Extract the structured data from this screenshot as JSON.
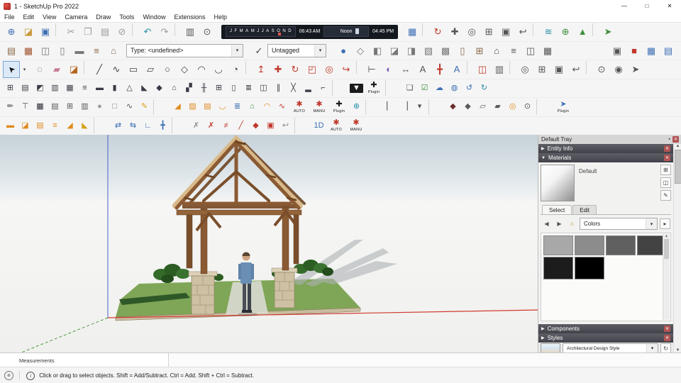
{
  "title_bar": {
    "title": "1 - SketchUp Pro 2022",
    "controls": {
      "minimize": "—",
      "maximize": "□",
      "close": "✕"
    }
  },
  "menu_bar": {
    "items": [
      "File",
      "Edit",
      "View",
      "Camera",
      "Draw",
      "Tools",
      "Window",
      "Extensions",
      "Help"
    ]
  },
  "glyphs": {
    "pin": "▪",
    "close": "✕",
    "collapsed": "▶",
    "expanded": "▼",
    "back": "◀",
    "forward": "▶",
    "home": "⌂",
    "details": "▸",
    "scroll_up": "▲",
    "scroll_down": "▼",
    "check": "✓",
    "caret": "▾",
    "select_arrow": "➤",
    "info": "i",
    "divider": "│",
    "geo": "⊕",
    "refresh": "↻"
  },
  "shadow_toolbar": {
    "months": [
      "J",
      "F",
      "M",
      "A",
      "M",
      "J",
      "J",
      "A",
      "S",
      "O",
      "N",
      "D"
    ],
    "time_start": "06:43 AM",
    "time_mid": "Noon",
    "time_end": "04:45 PM"
  },
  "tag_toolbar": {
    "type_value": "Type: <undefined>",
    "tag_value": "Untagged"
  },
  "toolbars": {
    "row1_left": [
      {
        "n": "new-icon",
        "g": "⊕",
        "c": "#3d6fb4"
      },
      {
        "n": "open-icon",
        "g": "◪",
        "c": "#c99a3c"
      },
      {
        "n": "save-icon",
        "g": "▣",
        "c": "#3d6fb4"
      },
      {
        "t": "sep"
      },
      {
        "n": "cut-icon",
        "g": "✂",
        "c": "#9a9a9a"
      },
      {
        "n": "copy-icon",
        "g": "❐",
        "c": "#9a9a9a"
      },
      {
        "n": "paste-icon",
        "g": "▤",
        "c": "#9a9a9a"
      },
      {
        "n": "erase-icon",
        "g": "⊘",
        "c": "#9a9a9a"
      },
      {
        "t": "sep"
      },
      {
        "n": "undo-icon",
        "g": "↶",
        "c": "#2a8fa8"
      },
      {
        "n": "redo-icon",
        "g": "↷",
        "c": "#9a9a9a"
      },
      {
        "t": "sep"
      },
      {
        "n": "print-icon",
        "g": "▥",
        "c": "#555555"
      },
      {
        "n": "model-info-icon",
        "g": "⊙",
        "c": "#555555"
      }
    ],
    "row1_right": [
      {
        "n": "shadow-settings-icon",
        "g": "▦",
        "c": "#3d6fb4"
      },
      {
        "t": "sep"
      },
      {
        "n": "orbit-icon",
        "g": "↻",
        "c": "#c0392b"
      },
      {
        "n": "pan-icon",
        "g": "✚",
        "c": "#555555"
      },
      {
        "n": "zoom-icon",
        "g": "◎",
        "c": "#555555"
      },
      {
        "n": "zoom-window-icon",
        "g": "⊞",
        "c": "#555555"
      },
      {
        "n": "zoom-extents-icon",
        "g": "▣",
        "c": "#555555"
      },
      {
        "n": "previous-view-icon",
        "g": "↩",
        "c": "#555555"
      },
      {
        "t": "sep"
      },
      {
        "n": "sandbox-icon",
        "g": "≋",
        "c": "#2a8fa8"
      },
      {
        "n": "add-location-icon",
        "g": "⊕",
        "c": "#3c8f3c"
      },
      {
        "n": "terrain-toggle-icon",
        "g": "▲",
        "c": "#3c8f3c"
      },
      {
        "t": "sep"
      },
      {
        "n": "export-icon",
        "g": "➤",
        "c": "#3c8f3c"
      }
    ],
    "row2_left": [
      {
        "n": "wall-tool-icon",
        "g": "▤",
        "c": "#8a6a4a"
      },
      {
        "n": "brick-tool-icon",
        "g": "▦",
        "c": "#a0522d"
      },
      {
        "n": "opening-tool-icon",
        "g": "◫",
        "c": "#777777"
      },
      {
        "n": "column-tool-icon",
        "g": "▯",
        "c": "#777777"
      },
      {
        "n": "slab-tool-icon",
        "g": "▬",
        "c": "#777777"
      },
      {
        "n": "stair-tool-icon",
        "g": "≡",
        "c": "#8a6a4a"
      },
      {
        "n": "roof-tool-icon",
        "g": "⌂",
        "c": "#8a6a4a"
      }
    ],
    "row2_shapes": [
      {
        "n": "sphere-tool-icon",
        "g": "●",
        "c": "#3d6fb4"
      },
      {
        "n": "polygon-tool-icon",
        "g": "◇",
        "c": "#777777"
      },
      {
        "n": "split-tool-icon",
        "g": "◧",
        "c": "#777777"
      },
      {
        "n": "solid-union-icon",
        "g": "◪",
        "c": "#777777"
      },
      {
        "n": "solid-subtract-icon",
        "g": "◨",
        "c": "#777777"
      },
      {
        "n": "solid-trim-icon",
        "g": "▧",
        "c": "#777777"
      },
      {
        "n": "solid-intersect-icon",
        "g": "▩",
        "c": "#777777"
      },
      {
        "n": "door-tool-icon",
        "g": "▯",
        "c": "#8a6a4a"
      },
      {
        "n": "window-tool-icon",
        "g": "⊞",
        "c": "#8a6a4a"
      },
      {
        "n": "house-tool-icon",
        "g": "⌂",
        "c": "#555555"
      },
      {
        "n": "fence-tool-icon",
        "g": "≡",
        "c": "#555555"
      },
      {
        "n": "frame-tool-icon",
        "g": "◫",
        "c": "#555555"
      },
      {
        "n": "grid-tool-icon",
        "g": "▦",
        "c": "#555555"
      }
    ],
    "row2_right": [
      {
        "n": "component-box-icon",
        "g": "▣",
        "c": "#555555"
      },
      {
        "n": "red-material-icon",
        "g": "■",
        "c": "#c0392b"
      },
      {
        "n": "blue-grid-icon",
        "g": "▦",
        "c": "#3d6fb4"
      },
      {
        "n": "layout-table-icon",
        "g": "▤",
        "c": "#3d6fb4"
      }
    ],
    "row3": [
      {
        "n": "lasso-select-icon",
        "g": "◌",
        "c": "#555555"
      },
      {
        "n": "eraser-icon",
        "g": "▰",
        "c": "#c77d9a"
      },
      {
        "n": "paint-bucket-icon",
        "g": "◪",
        "c": "#b5651d"
      },
      {
        "t": "sep"
      },
      {
        "n": "line-icon",
        "g": "╱",
        "c": "#444444"
      },
      {
        "n": "freehand-icon",
        "g": "∿",
        "c": "#444444"
      },
      {
        "n": "rectangle-icon",
        "g": "▭",
        "c": "#444444"
      },
      {
        "n": "rotated-rectangle-icon",
        "g": "▱",
        "c": "#444444"
      },
      {
        "n": "circle-icon",
        "g": "○",
        "c": "#444444"
      },
      {
        "n": "polygon-icon",
        "g": "◇",
        "c": "#444444"
      },
      {
        "n": "arc-icon",
        "g": "◠",
        "c": "#444444"
      },
      {
        "n": "two-point-arc-icon",
        "g": "◡",
        "c": "#444444"
      },
      {
        "n": "pie-icon",
        "g": "◔",
        "c": "#444444"
      },
      {
        "t": "sep"
      },
      {
        "n": "push-pull-icon",
        "g": "↥",
        "c": "#c0392b"
      },
      {
        "n": "move-icon",
        "g": "✚",
        "c": "#c0392b"
      },
      {
        "n": "rotate-icon",
        "g": "↻",
        "c": "#c0392b"
      },
      {
        "n": "scale-icon",
        "g": "◰",
        "c": "#c0392b"
      },
      {
        "n": "offset-icon",
        "g": "◎",
        "c": "#c0392b"
      },
      {
        "n": "follow-me-icon",
        "g": "↪",
        "c": "#c0392b"
      },
      {
        "t": "sep"
      },
      {
        "n": "tape-measure-icon",
        "g": "⊢",
        "c": "#555555"
      },
      {
        "n": "protractor-icon",
        "g": "◐",
        "c": "#7a5fb5"
      },
      {
        "n": "dimension-icon",
        "g": "↔",
        "c": "#555555"
      },
      {
        "n": "text-icon",
        "g": "A",
        "c": "#555555"
      },
      {
        "n": "axes-icon",
        "g": "╋",
        "c": "#c0392b"
      },
      {
        "n": "3d-text-icon",
        "g": "A",
        "c": "#3d6fb4"
      },
      {
        "t": "sep"
      },
      {
        "n": "section-plane-icon",
        "g": "◫",
        "c": "#c0392b"
      },
      {
        "n": "section-fill-icon",
        "g": "▥",
        "c": "#555555"
      },
      {
        "t": "sep"
      },
      {
        "n": "zoom-tool-icon",
        "g": "◎",
        "c": "#555555"
      },
      {
        "n": "zoom-window-tool-icon",
        "g": "⊞",
        "c": "#555555"
      },
      {
        "n": "zoom-extents-tool-icon",
        "g": "▣",
        "c": "#555555"
      },
      {
        "n": "previous-view-tool-icon",
        "g": "↩",
        "c": "#555555"
      },
      {
        "t": "sep"
      },
      {
        "n": "position-camera-icon",
        "g": "⊙",
        "c": "#555555"
      },
      {
        "n": "look-around-icon",
        "g": "◉",
        "c": "#555555"
      },
      {
        "n": "walk-icon",
        "g": "➤",
        "c": "#555555"
      }
    ],
    "row4": [
      {
        "n": "ruler-grid-icon",
        "g": "⊞",
        "c": "#3a3a46"
      },
      {
        "n": "wall-frame-icon",
        "g": "▤",
        "c": "#3a3a46"
      },
      {
        "n": "corner-frame-icon",
        "g": "◩",
        "c": "#3a3a46"
      },
      {
        "n": "stud-wall-icon",
        "g": "▥",
        "c": "#3a3a46"
      },
      {
        "n": "floor-frame-icon",
        "g": "▦",
        "c": "#3a3a46"
      },
      {
        "n": "joist-icon",
        "g": "≡",
        "c": "#3a3a46"
      },
      {
        "n": "beam-icon",
        "g": "▬",
        "c": "#3a3a46"
      },
      {
        "n": "post-icon",
        "g": "▮",
        "c": "#3a3a46"
      },
      {
        "n": "truss-icon",
        "g": "△",
        "c": "#3a3a46"
      },
      {
        "n": "rafter-icon",
        "g": "◣",
        "c": "#3a3a46"
      },
      {
        "n": "hip-roof-icon",
        "g": "◆",
        "c": "#3a3a46"
      },
      {
        "n": "gable-roof-icon",
        "g": "⌂",
        "c": "#3a3a46"
      },
      {
        "n": "stair-frame-icon",
        "g": "▞",
        "c": "#3a3a46"
      },
      {
        "n": "railing-icon",
        "g": "╫",
        "c": "#3a3a46"
      },
      {
        "n": "window-frame-icon",
        "g": "⊞",
        "c": "#3a3a46"
      },
      {
        "n": "door-frame-icon",
        "g": "▯",
        "c": "#3a3a46"
      },
      {
        "n": "louvre-icon",
        "g": "≣",
        "c": "#3a3a46"
      },
      {
        "n": "panel-icon",
        "g": "◫",
        "c": "#3a3a46"
      },
      {
        "n": "purlin-icon",
        "g": "∥",
        "c": "#3a3a46"
      },
      {
        "n": "brace-icon",
        "g": "╳",
        "c": "#3a3a46"
      },
      {
        "n": "foundation-icon",
        "g": "▂",
        "c": "#3a3a46"
      },
      {
        "n": "extrude-profile-icon",
        "g": "⌐",
        "c": "#3a3a46"
      },
      {
        "t": "sep"
      },
      {
        "n": "download-plugin-icon",
        "g": "▼",
        "c": "#ffffff",
        "bg": "#1b1b1b"
      },
      {
        "n": "plugin-store-icon",
        "g": "✚",
        "c": "#1b1b1b",
        "label": "Plugin"
      },
      {
        "t": "sep"
      },
      {
        "n": "package-icon",
        "g": "❏",
        "c": "#555555"
      },
      {
        "n": "checkbox-icon",
        "g": "☑",
        "c": "#3c8f3c"
      },
      {
        "n": "cloud-icon",
        "g": "☁",
        "c": "#3d6fb4"
      },
      {
        "n": "globe-small-icon",
        "g": "◍",
        "c": "#3d6fb4"
      },
      {
        "n": "refresh-icon",
        "g": "↺",
        "c": "#3d6fb4"
      },
      {
        "n": "sync-icon",
        "g": "↻",
        "c": "#2a8fa8"
      }
    ],
    "row5": [
      {
        "n": "pencil-ruler-icon",
        "g": "✏",
        "c": "#555555"
      },
      {
        "n": "tsquare-icon",
        "g": "⊤",
        "c": "#555555"
      },
      {
        "n": "cad-screen-icon",
        "g": "▦",
        "c": "#22262e"
      },
      {
        "n": "blinds-icon",
        "g": "▤",
        "c": "#555555"
      },
      {
        "n": "grid-add-icon",
        "g": "⊞",
        "c": "#555555"
      },
      {
        "n": "column-grid-icon",
        "g": "▥",
        "c": "#555555"
      },
      {
        "n": "gray-sphere-icon",
        "g": "●",
        "c": "#9a9a9a"
      },
      {
        "n": "white-box-icon",
        "g": "□",
        "c": "#777777"
      },
      {
        "n": "spring-icon",
        "g": "∿",
        "c": "#555555"
      },
      {
        "n": "marker-pen-icon",
        "g": "✎",
        "c": "#d4a017"
      },
      {
        "t": "sep"
      },
      {
        "n": "ramp-icon",
        "g": "◢",
        "c": "#e08a1e"
      },
      {
        "n": "roof-tile-icon",
        "g": "▨",
        "c": "#e08a1e"
      },
      {
        "n": "shingle-icon",
        "g": "▤",
        "c": "#e08a1e"
      },
      {
        "n": "gutter-icon",
        "g": "◡",
        "c": "#e08a1e"
      },
      {
        "n": "ladder-grid-icon",
        "g": "≣",
        "c": "#3d6fb4"
      },
      {
        "n": "green-canopy-icon",
        "g": "⌂",
        "c": "#3c8f3c"
      },
      {
        "n": "dome-icon",
        "g": "◠",
        "c": "#e08a1e"
      },
      {
        "n": "hose-icon",
        "g": "∿",
        "c": "#c0392b"
      },
      {
        "n": "auto-mode-icon",
        "g": "✱",
        "c": "#c0392b",
        "label": "AUTO"
      },
      {
        "n": "manual-mode-icon",
        "g": "✱",
        "c": "#c0392b",
        "label": "MANU"
      },
      {
        "n": "plugin-tools-icon",
        "g": "✚",
        "c": "#1b1b1b",
        "label": "Plugin"
      },
      {
        "n": "globe-icon",
        "g": "⊕",
        "c": "#2a8fa8"
      },
      {
        "t": "sep"
      },
      {
        "n": "thin-column-icon",
        "g": "▏",
        "c": "#555555"
      },
      {
        "n": "thin-column2-icon",
        "g": "▕",
        "c": "#555555"
      },
      {
        "n": "drop-marker-icon",
        "g": "▾",
        "c": "#555555"
      },
      {
        "t": "sep"
      },
      {
        "n": "dark-roof-icon",
        "g": "◆",
        "c": "#6b2b2b"
      },
      {
        "n": "slate-roof-icon",
        "g": "◆",
        "c": "#5a5a5a"
      },
      {
        "n": "skew-panel-icon",
        "g": "▱",
        "c": "#5a5a5a"
      },
      {
        "n": "flat-panel-icon",
        "g": "▰",
        "c": "#5a5a5a"
      },
      {
        "n": "torus-icon",
        "g": "◎",
        "c": "#e08a1e"
      },
      {
        "n": "mannequin-icon",
        "g": "⊙",
        "c": "#555555"
      },
      {
        "t": "sep"
      },
      {
        "n": "plugin-lightning-icon",
        "g": "➤",
        "c": "#3d6fb4",
        "label": "Plugin"
      }
    ],
    "row6": [
      {
        "n": "sheet-icon",
        "g": "▬",
        "c": "#e08a1e"
      },
      {
        "n": "folded-sheet-icon",
        "g": "◪",
        "c": "#e08a1e"
      },
      {
        "n": "corrugated-icon",
        "g": "▤",
        "c": "#e08a1e"
      },
      {
        "n": "stacked-sheets-icon",
        "g": "≡",
        "c": "#e08a1e"
      },
      {
        "n": "wedge-icon",
        "g": "◢",
        "c": "#e08a1e"
      },
      {
        "n": "ramp-yellow-icon",
        "g": "◣",
        "c": "#d4a017"
      },
      {
        "t": "sep"
      },
      {
        "n": "swap-arrows-icon",
        "g": "⇄",
        "c": "#3d6fb4"
      },
      {
        "n": "mirror-icon",
        "g": "⇆",
        "c": "#3d6fb4"
      },
      {
        "n": "angle-icon",
        "g": "∟",
        "c": "#3d6fb4"
      },
      {
        "n": "cross-axis-icon",
        "g": "╋",
        "c": "#3d6fb4"
      },
      {
        "t": "sep"
      },
      {
        "n": "gray-x-icon",
        "g": "✗",
        "c": "#8a8a8a"
      },
      {
        "n": "red-x-icon",
        "g": "✗",
        "c": "#c0392b"
      },
      {
        "n": "hatch-marks-icon",
        "g": "≠",
        "c": "#c0392b"
      },
      {
        "n": "red-slash-icon",
        "g": "╱",
        "c": "#c0392b"
      },
      {
        "n": "red-roof-icon",
        "g": "◆",
        "c": "#c0392b"
      },
      {
        "n": "marked-box-icon",
        "g": "▣",
        "c": "#c0392b"
      },
      {
        "n": "hook-icon",
        "g": "↩",
        "c": "#8a8a8a"
      },
      {
        "t": "sep"
      },
      {
        "n": "one-d-icon",
        "g": "1D",
        "c": "#3d6fb4"
      },
      {
        "n": "auto-mode2-icon",
        "g": "✱",
        "c": "#c0392b",
        "label": "AUTO"
      },
      {
        "n": "manual-mode2-icon",
        "g": "✱",
        "c": "#c0392b",
        "label": "MANU"
      }
    ]
  },
  "viewport": {
    "axes": {
      "x_color": "#d23b2f",
      "y_color": "#4a9a3c",
      "z_color": "#4a5fd0"
    }
  },
  "tray": {
    "title": "Default Tray",
    "sections": {
      "entity_info": {
        "label": "Entity Info"
      },
      "materials": {
        "label": "Materials"
      },
      "components": {
        "label": "Components"
      },
      "styles": {
        "label": "Styles"
      }
    },
    "materials": {
      "current": "Default",
      "tabs": {
        "select": "Select",
        "edit": "Edit"
      },
      "collection": "Colors",
      "swatches_row1": [
        "#a8a8a8",
        "#8c8c8c",
        "#606060",
        "#434343"
      ],
      "swatches_row2": [
        "#1c1c1c",
        "#000000"
      ]
    },
    "styles": {
      "current": "Architectural Design Style"
    }
  },
  "status_bar": {
    "measurements_label": "Measurements",
    "hint": "Click or drag to select objects. Shift = Add/Subtract. Ctrl = Add. Shift + Ctrl = Subtract."
  }
}
